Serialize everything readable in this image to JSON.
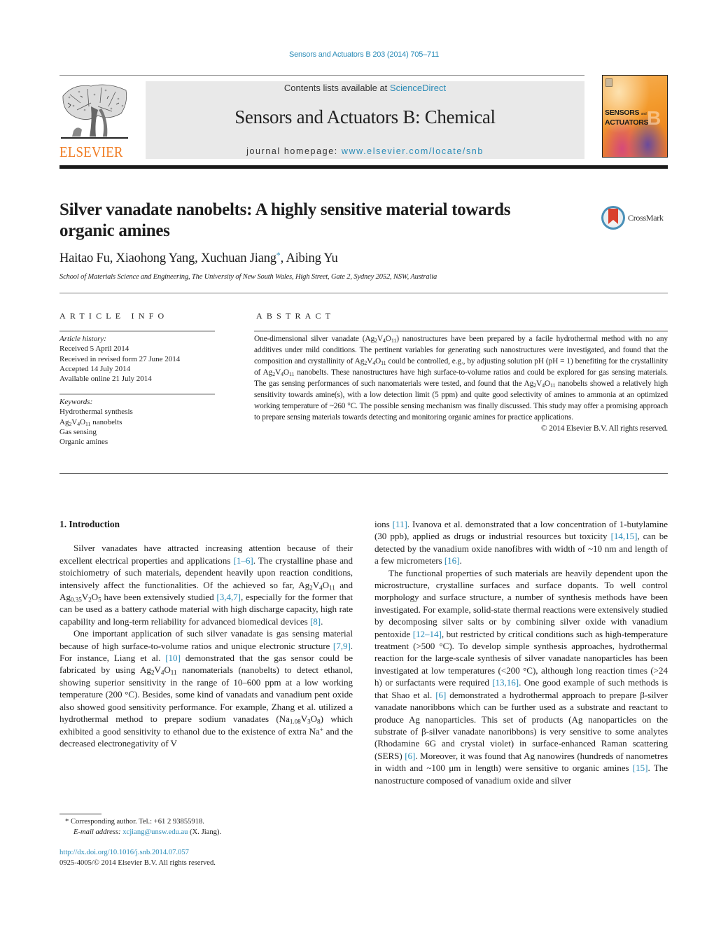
{
  "citation": "Sensors and Actuators B 203 (2014) 705–711",
  "masthead": {
    "publisher_logo_text": "ELSEVIER",
    "contents_prefix": "Contents lists available at ",
    "contents_link": "ScienceDirect",
    "journal_title": "Sensors and Actuators B: Chemical",
    "homepage_prefix": "journal homepage: ",
    "homepage_link": "www.elsevier.com/locate/snb",
    "cover": {
      "line1": "SENSORS",
      "and": "and",
      "line2": "ACTUATORS",
      "letter": "B",
      "colors": {
        "primary": "#f39a2c",
        "accent": "#6a4a9c"
      }
    }
  },
  "colors": {
    "link": "#2a8bb7",
    "elsevier_orange": "#f07e26",
    "masthead_bg": "#e9e9e9"
  },
  "article": {
    "title": "Silver vanadate nanobelts: A highly sensitive material towards organic amines",
    "crossmark_label": "CrossMark",
    "authors": [
      {
        "name": "Haitao Fu"
      },
      {
        "name": "Xiaohong Yang"
      },
      {
        "name": "Xuchuan Jiang",
        "corresponding_mark": "*"
      },
      {
        "name": "Aibing Yu"
      }
    ],
    "affiliation": "School of Materials Science and Engineering, The University of New South Wales, High Street, Gate 2, Sydney 2052, NSW, Australia"
  },
  "article_info": {
    "heading": "ARTICLE INFO",
    "history_label": "Article history:",
    "history": [
      "Received 5 April 2014",
      "Received in revised form 27 June 2014",
      "Accepted 14 July 2014",
      "Available online 21 July 2014"
    ],
    "keywords_label": "Keywords:",
    "keywords": [
      "Hydrothermal synthesis",
      "Ag₂V₄O₁₁ nanobelts",
      "Gas sensing",
      "Organic amines"
    ]
  },
  "abstract": {
    "heading": "ABSTRACT",
    "s1": "One-dimensional silver vanadate (",
    "s2": ") nanostructures have been prepared by a facile hydrothermal method with no any additives under mild conditions. The pertinent variables for generating such nanostructures were investigated, and found that the composition and crystallinity of ",
    "s3": " could be controlled, e.g., by adjusting solution pH (pH = 1) benefiting for the crystallinity of ",
    "s4": " nanobelts. These nanostructures have high surface-to-volume ratios and could be explored for gas sensing materials. The gas sensing performances of such nanomaterials were tested, and found that the ",
    "s5": " nanobelts showed a relatively high sensitivity towards amine(s), with a low detection limit (5 ppm) and quite good selectivity of amines to ammonia at an optimized working temperature of ~260 °C. The possible sensing mechanism was finally discussed. This study may offer a promising approach to prepare sensing materials towards detecting and monitoring organic amines for practice applications.",
    "copyright": "© 2014 Elsevier B.V. All rights reserved."
  },
  "formula": {
    "ag2v4o11": {
      "a": "Ag",
      "a_n": "2",
      "b": "V",
      "b_n": "4",
      "c": "O",
      "c_n": "11"
    }
  },
  "body": {
    "section_heading": "1.  Introduction",
    "left": {
      "p1": {
        "t1": "Silver vanadates have attracted increasing attention because of their excellent electrical properties and applications ",
        "r1": "[1–6]",
        "t2": ". The crystalline phase and stoichiometry of such materials, dependent heavily upon reaction conditions, intensively affect the functionalities. Of the achieved so far, ",
        "t3": " and Ag",
        "sub_035": "0.35",
        "t4": "V",
        "sub_2": "2",
        "t5": "O",
        "sub_5": "5",
        "t6": " have been extensively studied ",
        "r2": "[3,4,7]",
        "t7": ", especially for the former that can be used as a battery cathode material with high discharge capacity, high rate capability and long-term reliability for advanced biomedical devices ",
        "r3": "[8]",
        "t8": "."
      },
      "p2": {
        "t1": "One important application of such silver vanadate is gas sensing material because of high surface-to-volume ratios and unique electronic structure ",
        "r1": "[7,9]",
        "t2": ". For instance, Liang et al. ",
        "r2": "[10]",
        "t3": " demonstrated that the gas sensor could be fabricated by using ",
        "t4": " nanomaterials (nanobelts) to detect ethanol, showing superior sensitivity in the range of 10–600 ppm at a low working temperature (200 °C). Besides, some kind of vanadats and vanadium pent oxide also showed good sensitivity performance. For example, Zhang et al. utilized a hydrothermal method to prepare sodium vanadates (Na",
        "sub_108": "1.08",
        "t5": "V",
        "sub_3": "3",
        "t6": "O",
        "sub_8": "8",
        "t7": ") which exhibited a good sensitivity to ethanol due to the existence of extra Na",
        "sup_plus": "+",
        "t8": " and the decreased electronegativity of V"
      }
    },
    "right": {
      "p1": {
        "t0": "ions ",
        "r0": "[11]",
        "t1": ". Ivanova et al. demonstrated that a low concentration of 1-butylamine (30 ppb), applied as drugs or industrial resources but toxicity ",
        "r1": "[14,15]",
        "t2": ", can be detected by the vanadium oxide nanofibres with width of ~10 nm and length of a few micrometers ",
        "r2": "[16]",
        "t3": "."
      },
      "p2": {
        "t1": "The functional properties of such materials are heavily dependent upon the microstructure, crystalline surfaces and surface dopants. To well control morphology and surface structure, a number of synthesis methods have been investigated. For example, solid-state thermal reactions were extensively studied by decomposing silver salts or by combining silver oxide with vanadium pentoxide ",
        "r1": "[12–14]",
        "t2": ", but restricted by critical conditions such as high-temperature treatment (>500 °C). To develop simple synthesis approaches, hydrothermal reaction for the large-scale synthesis of silver vanadate nanoparticles has been investigated at low temperatures (<200 °C), although long reaction times (>24 h) or surfactants were required ",
        "r2": "[13,16]",
        "t3": ". One good example of such methods is that Shao et al. ",
        "r3": "[6]",
        "t4": " demonstrated a hydrothermal approach to prepare β-silver vanadate nanoribbons which can be further used as a substrate and reactant to produce Ag nanoparticles. This set of products (Ag nanoparticles on the substrate of β-silver vanadate nanoribbons) is very sensitive to some analytes (Rhodamine 6G and crystal violet) in surface-enhanced Raman scattering (SERS) ",
        "r4": "[6]",
        "t5": ". Moreover, it was found that Ag nanowires (hundreds of nanometres in width and ~100 μm in length) were sensitive to organic amines ",
        "r5": "[15]",
        "t6": ". The nanostructure composed of vanadium oxide and silver"
      }
    }
  },
  "footnote": {
    "mark": "*",
    "corresponding": " Corresponding author. Tel.: +61 2 93855918.",
    "email_label": "E-mail address: ",
    "email": "xcjiang@unsw.edu.au",
    "email_suffix": " (X. Jiang).",
    "doi": "http://dx.doi.org/10.1016/j.snb.2014.07.057",
    "issn_copyright": "0925-4005/© 2014 Elsevier B.V. All rights reserved."
  }
}
